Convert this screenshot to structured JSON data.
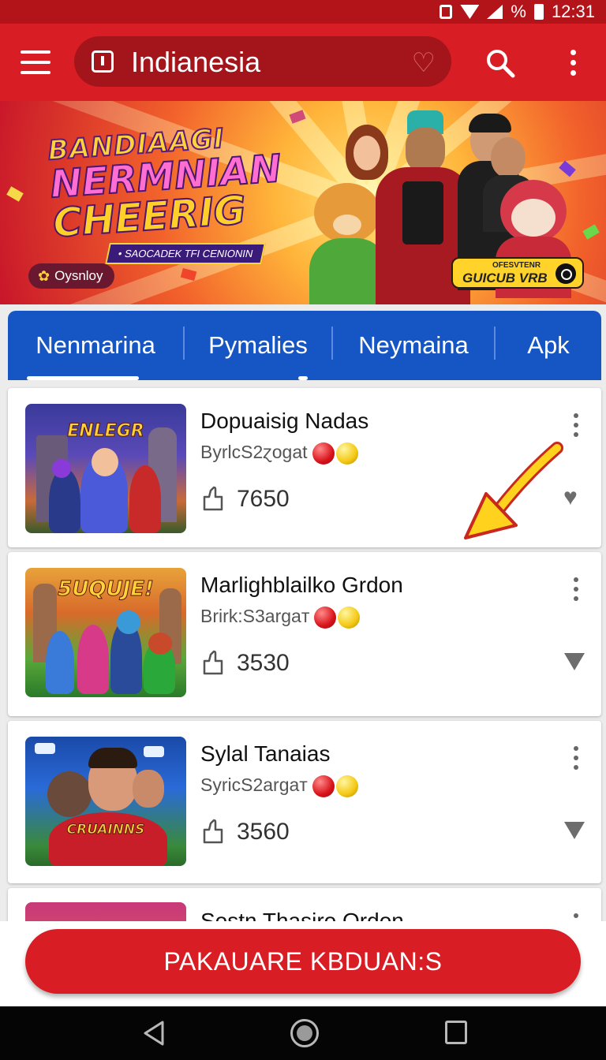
{
  "status_bar": {
    "percent": "%",
    "time": "12:31"
  },
  "app_bar": {
    "title": "Indianesia",
    "icons": [
      "menu-icon",
      "app-icon",
      "heart-icon",
      "search-icon",
      "more-icon"
    ]
  },
  "banner": {
    "title_line1": "BANDIAAGI",
    "title_line2": "NERMNIAN",
    "title_line3": "CHEERIG",
    "tagline": "• SAOCADEK TFI CENIONIN",
    "chip_left": "Oysnloy",
    "chip_right_small": "OFESVTENR",
    "chip_right_big": "GUICUB VRB"
  },
  "tabs": [
    {
      "label": "Nenmarina",
      "selected": true
    },
    {
      "label": "Pymalies",
      "selected": false
    },
    {
      "label": "Neymaina",
      "selected": false
    },
    {
      "label": "Apk",
      "selected": false
    }
  ],
  "list": {
    "items": [
      {
        "title": "Dopuaisig Nadas",
        "subtitle": "ByrlcS2ɀogat",
        "count": "7650",
        "thumb_text": "ENLEGR"
      },
      {
        "title": "Marlighblailko Grdon",
        "subtitle": "Brirk:S3argaт",
        "count": "3530",
        "thumb_text": "5UQUJE!"
      },
      {
        "title": "Sylal Tanaias",
        "subtitle": "SyricS2argaт",
        "count": "3560",
        "thumb_text": "CRUAINNS"
      },
      {
        "title": "Sostn Thasiro Qrdon",
        "subtitle": "",
        "count": "",
        "thumb_text": ""
      }
    ]
  },
  "cta": {
    "label": "PAKAUARE KBDUAN:S"
  },
  "colors": {
    "primary": "#d81e24",
    "tab_bar": "#1656c4",
    "status_bar": "#b3141a"
  }
}
